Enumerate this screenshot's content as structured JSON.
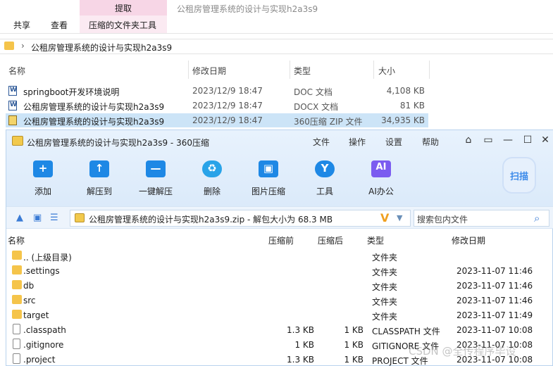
{
  "explorer": {
    "context_tab": "提取",
    "window_title": "公租房管理系统的设计与实现h2a3s9",
    "tabs": [
      "共享",
      "查看",
      "压缩的文件夹工具"
    ],
    "address_path": "公租房管理系统的设计与实现h2a3s9",
    "columns": {
      "name": "名称",
      "date": "修改日期",
      "type": "类型",
      "size": "大小"
    },
    "files": [
      {
        "name": "springboot开发环境说明",
        "date": "2023/12/9 18:47",
        "type": "DOC 文档",
        "size": "4,108 KB",
        "icon": "word-doc-icon"
      },
      {
        "name": "公租房管理系统的设计与实现h2a3s9",
        "date": "2023/12/9 18:47",
        "type": "DOCX 文档",
        "size": "81 KB",
        "icon": "word-docx-icon"
      },
      {
        "name": "公租房管理系统的设计与实现h2a3s9",
        "date": "2023/12/9 18:47",
        "type": "360压缩 ZIP 文件",
        "size": "34,935 KB",
        "icon": "zip-archive-icon",
        "selected": true
      }
    ]
  },
  "zip360": {
    "title": "公租房管理系统的设计与实现h2a3s9 - 360压缩",
    "menu": [
      "文件",
      "操作",
      "设置",
      "帮助"
    ],
    "toolbar": [
      {
        "label": "添加",
        "icon": "add-icon",
        "sym": "+"
      },
      {
        "label": "解压到",
        "icon": "extract-to-icon",
        "sym": "↑"
      },
      {
        "label": "一键解压",
        "icon": "one-click-extract-icon",
        "sym": "—"
      },
      {
        "label": "删除",
        "icon": "delete-icon",
        "sym": "🗑"
      },
      {
        "label": "图片压缩",
        "icon": "image-compress-icon",
        "sym": "▣"
      },
      {
        "label": "工具",
        "icon": "tools-icon",
        "sym": "Y"
      },
      {
        "label": "AI办公",
        "icon": "ai-office-icon",
        "sym": "AI"
      }
    ],
    "scan_label": "扫描",
    "path_text": "公租房管理系统的设计与实现h2a3s9.zip - 解包大小为 68.3 MB",
    "search_placeholder": "搜索包内文件",
    "columns": {
      "name": "名称",
      "compressed": "压缩前",
      "uncompressed": "压缩后",
      "type": "类型",
      "date": "修改日期"
    },
    "items": [
      {
        "name": ".. (上级目录)",
        "before": "",
        "after": "",
        "type": "文件夹",
        "date": "",
        "kind": "folder"
      },
      {
        "name": ".settings",
        "before": "",
        "after": "",
        "type": "文件夹",
        "date": "2023-11-07 11:46",
        "kind": "folder"
      },
      {
        "name": "db",
        "before": "",
        "after": "",
        "type": "文件夹",
        "date": "2023-11-07 11:46",
        "kind": "folder"
      },
      {
        "name": "src",
        "before": "",
        "after": "",
        "type": "文件夹",
        "date": "2023-11-07 11:46",
        "kind": "folder"
      },
      {
        "name": "target",
        "before": "",
        "after": "",
        "type": "文件夹",
        "date": "2023-11-07 11:49",
        "kind": "folder"
      },
      {
        "name": ".classpath",
        "before": "1.3 KB",
        "after": "1 KB",
        "type": "CLASSPATH 文件",
        "date": "2023-11-07 10:08",
        "kind": "file"
      },
      {
        "name": ".gitignore",
        "before": "1 KB",
        "after": "1 KB",
        "type": "GITIGNORE 文件",
        "date": "2023-11-07 10:08",
        "kind": "file"
      },
      {
        "name": ".project",
        "before": "1.3 KB",
        "after": "1 KB",
        "type": "PROJECT 文件",
        "date": "2023-11-07 10:08",
        "kind": "file"
      }
    ]
  },
  "watermark": "CSDN @全传程序毕设",
  "colors": {
    "accent": "#1e88e5",
    "selection": "#cce4f7",
    "context_band": "#f7d6e6"
  }
}
